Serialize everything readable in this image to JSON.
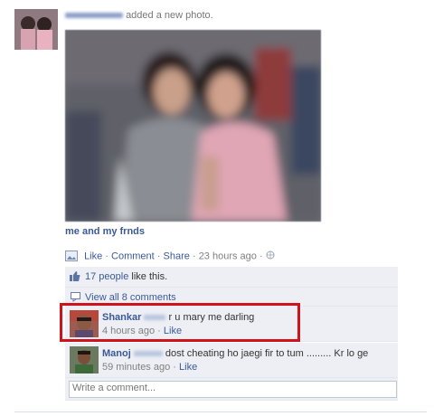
{
  "post": {
    "author_blurred": "Kishika Mano",
    "action": "added a new photo.",
    "caption": "me and my frnds"
  },
  "actions": {
    "like": "Like",
    "comment": "Comment",
    "share": "Share",
    "time": "23 hours ago",
    "sep": "·"
  },
  "likes": {
    "count_text": "17 people",
    "suffix": "like this."
  },
  "view_all": "View all 8 comments",
  "comments": [
    {
      "author": "Shankar",
      "author_blurred": "Kolar",
      "text": "r u mary me darling",
      "time": "4 hours ago",
      "like": "Like"
    },
    {
      "author": "Manoj",
      "author_blurred": "Sabeel",
      "text": "dost cheating ho jaegi fir to tum ......... Kr lo ge",
      "time": "59 minutes ago",
      "like": "Like"
    }
  ],
  "write_placeholder": "Write a comment...",
  "colors": {
    "link": "#3b5998",
    "highlight": "#d0121a",
    "panel": "#edeff4"
  }
}
